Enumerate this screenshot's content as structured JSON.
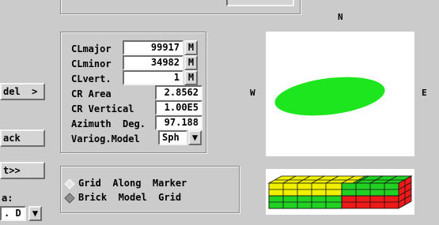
{
  "left_buttons": {
    "model_label": "del  >",
    "back_label": "ack",
    "next_label": "t>>",
    "area_label": "a:",
    "select_value": ". D"
  },
  "params": {
    "rows": [
      {
        "label": "CLmajor",
        "value": "99917",
        "unit": "M"
      },
      {
        "label": "CLminor",
        "value": "34982",
        "unit": "M"
      },
      {
        "label": "CLvert.",
        "value": "1",
        "unit": "M"
      }
    ],
    "cr_area_label": "CR Area",
    "cr_area_value": "2.8562",
    "cr_vertical_label": "CR Vertical",
    "cr_vertical_value": "1.00E5",
    "azimuth_label": "Azimuth  Deg.",
    "azimuth_value": "97.188",
    "variog_label": "Variog.Model",
    "variog_value": "Sph"
  },
  "compass": {
    "north": "N",
    "west": "W",
    "east": "E"
  },
  "options": {
    "grid_along_marker": "Grid  Along  Marker",
    "brick_model_grid": "Brick  Model  Grid",
    "selected": "brick_model_grid"
  },
  "colors": {
    "ellipse": "#1ee61e",
    "brick_yellow": "#f0f000",
    "brick_green": "#22d222",
    "brick_red": "#ee1a1a"
  }
}
